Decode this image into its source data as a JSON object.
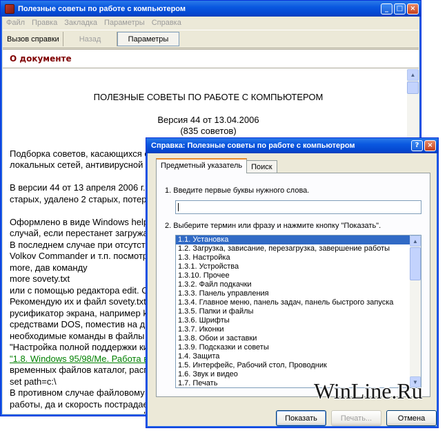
{
  "main_window": {
    "title": "Полезные советы по работе с компьютером",
    "controls": {
      "minimize": "_",
      "maximize": "□",
      "close": "×"
    },
    "menu": [
      "Файл",
      "Правка",
      "Закладка",
      "Параметры",
      "Справка"
    ],
    "toolbar": {
      "help_call": "Вызов справки",
      "back": "Назад",
      "options": "Параметры"
    },
    "section_header": "О документе",
    "document": {
      "title": "ПОЛЕЗНЫЕ СОВЕТЫ ПО РАБОТЕ С КОМПЬЮТЕРОМ",
      "version_line1": "Версия 44 от 13.04.2006",
      "version_line2": "(835 советов)",
      "lines": [
        "Подборка советов, касающихся с",
        "локальных сетей, антивирусной з",
        "",
        "В версии 44 от 13 апреля 2006 г.",
        "старых, удалено 2 старых, потер",
        "",
        "Оформлено в виде Windows help",
        "случай, если перестанет загружа",
        "В последнем случае при отсутст",
        "Volkov Commander и т.п. посмотр",
        "more, дав команду",
        "more sovety.txt",
        "или с помощью редактора edit. С",
        "Рекомендую их и файл sovety.txt",
        "русификатор экрана, например k",
        "средствами DOS, поместив на ди",
        "необходимые команды в файлы с",
        "\"Настройка полной поддержки ки",
        "\"1.8. Windows 95/98/Me. Работа в",
        "временных файлов каталог, расп",
        "set path=c:\\",
        "В противном случае файловому м",
        "работы, да и скорость пострадае",
        "недоступен, так как она читает ф"
      ],
      "link_line_index": 18
    }
  },
  "dialog": {
    "title": "Справка: Полезные советы по работе с компьютером",
    "controls": {
      "help": "?",
      "close": "×"
    },
    "tabs": [
      "Предметный указатель",
      "Поиск"
    ],
    "active_tab": 0,
    "step1_label": "1. Введите первые буквы нужного слова.",
    "search_value": "",
    "step2_label": "2. Выберите термин или фразу и нажмите кнопку \"Показать\".",
    "terms": [
      "1.1. Установка",
      "1.2. Загрузка, зависание, перезагрузка, завершение работы",
      "1.3. Настройка",
      "1.3.1. Устройства",
      "1.3.10. Прочее",
      "1.3.2. Файл подкачки",
      "1.3.3. Панель управления",
      "1.3.4. Главное меню, панель задач, панель быстрого запуска",
      "1.3.5. Папки и файлы",
      "1.3.6. Шрифты",
      "1.3.7. Иконки",
      "1.3.8. Обои и заставки",
      "1.3.9. Подсказки и советы",
      "1.4. Защита",
      "1.5. Интерфейс, Рабочий стол, Проводник",
      "1.6. Звук и видео",
      "1.7. Печать"
    ],
    "selected_term_index": 0,
    "buttons": {
      "show": "Показать",
      "print": "Печать...",
      "cancel": "Отмена"
    }
  },
  "watermark": "WinLine.Ru",
  "colors": {
    "title_bar": "#0a58e0",
    "dialog_face": "#ece9d8",
    "selection": "#316ac5",
    "header_text": "#800000",
    "link": "#008000"
  }
}
